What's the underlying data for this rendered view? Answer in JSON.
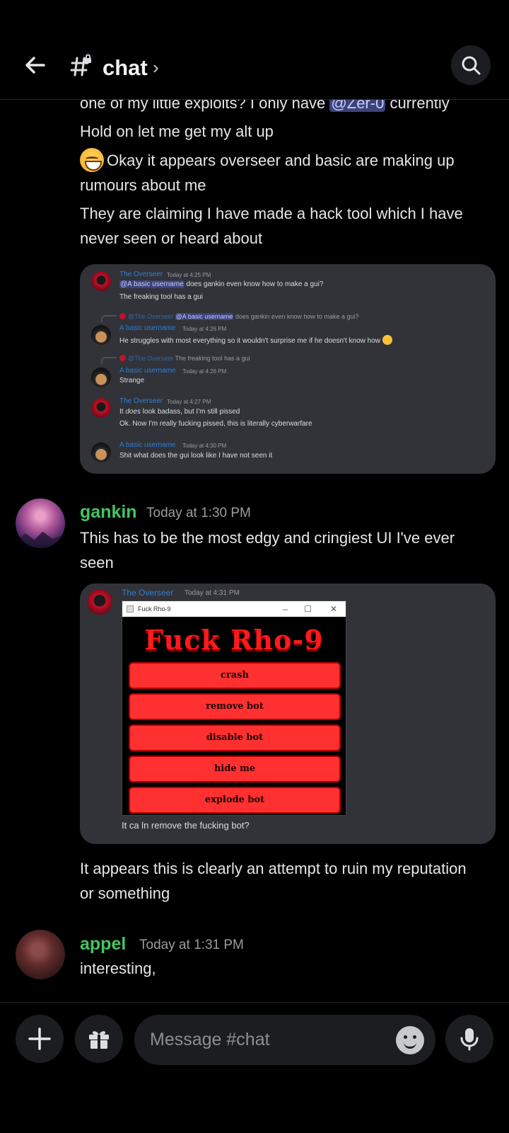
{
  "header": {
    "channel_name": "chat",
    "chevron": "›",
    "back_icon": "arrow-left-icon",
    "channel_icon": "hash-lock-icon",
    "search_icon": "search-icon"
  },
  "colors": {
    "green_name": "#43c462",
    "blue_name": "#2f7ed8",
    "mention_bg": "#3c437b",
    "app_red": "#ff3030"
  },
  "messages": {
    "m0": {
      "line1_before": "one of my little exploits? I only have ",
      "line1_mention": "@Zer-0",
      "line1_after": " currently",
      "line2": "Hold on let me get my alt up",
      "line3a": "Okay it appears overseer and basic are making up",
      "line3b": "rumours about me",
      "line4a": "They are claiming I have made a hack tool which I have",
      "line4b": "never seen or heard about"
    },
    "embed1": {
      "r1_name": "The Overseer",
      "r1_time": "Today at 4:25 PM",
      "r1_mention": "@A basic username",
      "r1_text": " does gankin even know how to make a gui?",
      "r1_text2": "The freaking tool has a gui",
      "r2_reply_name": "@The Overseer",
      "r2_reply_mention": "@A basic username",
      "r2_reply_text": " does gankin even know how to make a gui?",
      "r2_name": "A basic username",
      "r2_time": "Today at 4:26 PM",
      "r2_text": "He struggles with most everything so it wouldn't surprise me if he doesn't know how",
      "r3_reply_name": "@The Overseer",
      "r3_reply_text": " The freaking tool has a gui",
      "r3_name": "A basic username",
      "r3_time": "Today at 4:26 PM",
      "r3_text": "Strange",
      "r4_name": "The Overseer",
      "r4_time": "Today at 4:27 PM",
      "r4_text_a": "It ",
      "r4_text_em": "does",
      "r4_text_b": " look badass, but I'm still pissed",
      "r4_text2": "Ok. Now I'm really fucking pissed, this is literally cyberwarfare",
      "r5_name": "A basic username",
      "r5_time": "Today at 4:30 PM",
      "r5_text": "Shit what does the gui look like I have not seen it"
    },
    "gankin": {
      "author": "gankin",
      "time": "Today at 1:30 PM",
      "line1": "This has to be the most edgy and cringiest UI I've ever",
      "line2": "seen"
    },
    "embed2": {
      "name": "The Overseer",
      "time": "Today at 4:31 PM",
      "window_title": "Fuck Rho-9",
      "app_title": "Fuck Rho-9",
      "buttons": [
        "crash",
        "remove bot",
        "disable bot",
        "hide me",
        "explode bot"
      ],
      "caption": "It ca ln remove the fucking bot?"
    },
    "gankin2": {
      "line1": "It appears this is clearly an attempt to ruin my reputation",
      "line2": "or something"
    },
    "appel": {
      "author": "appel",
      "time": "Today at 1:31 PM",
      "text": "interesting,"
    }
  },
  "composer": {
    "placeholder": "Message #chat",
    "add_icon": "plus-icon",
    "gift_icon": "gift-icon",
    "emoji_icon": "emoji-icon",
    "mic_icon": "microphone-icon"
  }
}
